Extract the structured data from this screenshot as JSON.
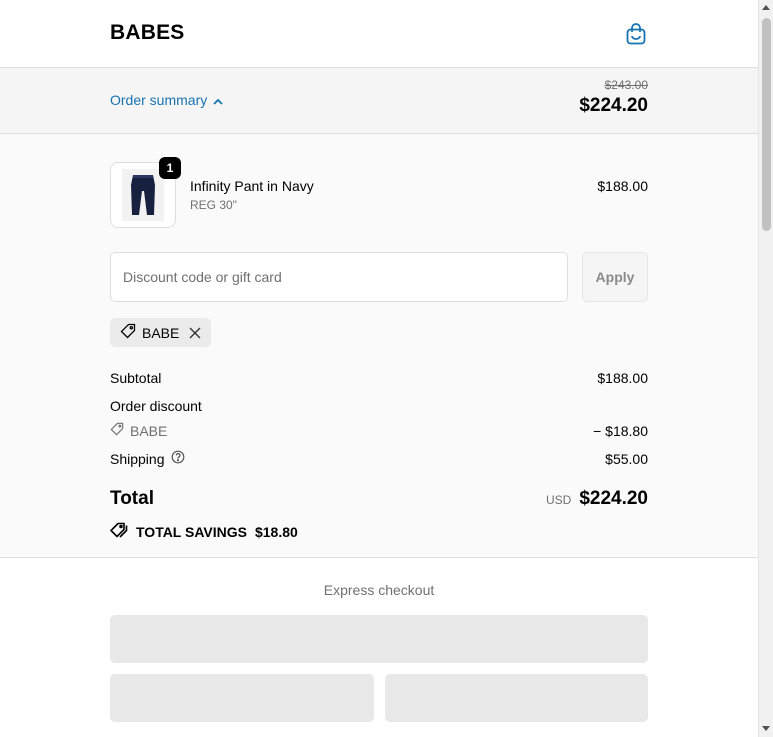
{
  "header": {
    "brand": "BABES",
    "bag_icon": "shopping-bag-icon"
  },
  "summary_bar": {
    "toggle_label": "Order summary",
    "original_total": "$243.00",
    "total": "$224.20"
  },
  "item": {
    "quantity": "1",
    "name": "Infinity Pant in Navy",
    "variant": "REG 30\"",
    "price": "$188.00"
  },
  "discount": {
    "placeholder": "Discount code or gift card",
    "value": "",
    "apply_label": "Apply",
    "applied_code": "BABE"
  },
  "totals": {
    "subtotal_label": "Subtotal",
    "subtotal_value": "$188.00",
    "order_discount_label": "Order discount",
    "discount_code": "BABE",
    "discount_value": "− $18.80",
    "shipping_label": "Shipping",
    "shipping_value": "$55.00",
    "total_label": "Total",
    "currency": "USD",
    "total_value": "$224.20",
    "savings_label": "TOTAL SAVINGS",
    "savings_value": "$18.80"
  },
  "express": {
    "title": "Express checkout"
  },
  "colors": {
    "accent": "#1773b0",
    "panel": "#fafafa",
    "bar": "#f5f5f5"
  }
}
